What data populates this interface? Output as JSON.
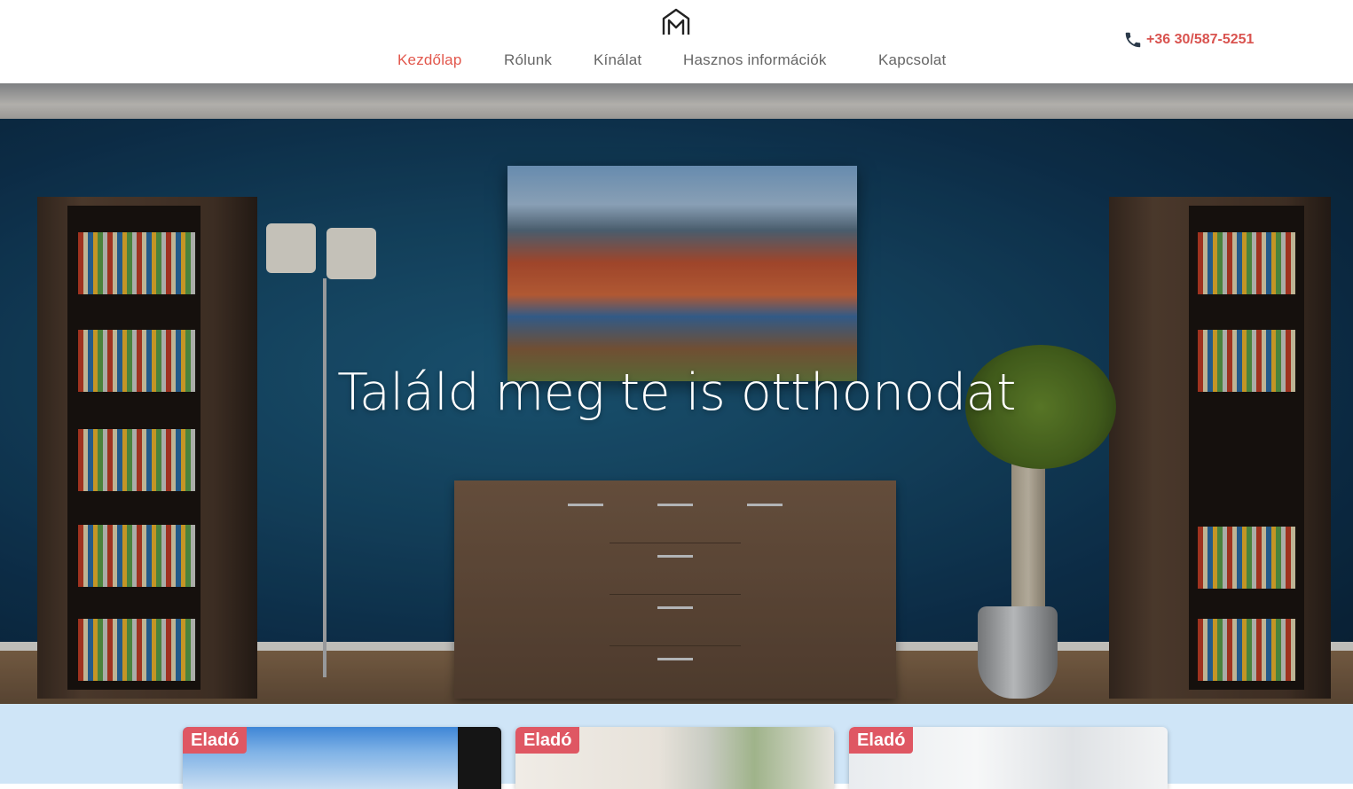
{
  "header": {
    "logo_icon": "house-m-logo-icon",
    "nav": [
      {
        "label": "Kezdőlap",
        "active": true
      },
      {
        "label": "Rólunk",
        "active": false
      },
      {
        "label": "Kínálat",
        "active": false
      },
      {
        "label": "Hasznos információk",
        "active": false
      },
      {
        "label": "Kapcsolat",
        "active": false
      }
    ],
    "phone": {
      "icon": "phone-icon",
      "number": "+36 30/587-5251"
    }
  },
  "hero": {
    "title": "Találd meg te is otthonodat"
  },
  "listings": [
    {
      "badge": "Eladó"
    },
    {
      "badge": "Eladó"
    },
    {
      "badge": "Eladó"
    }
  ],
  "colors": {
    "accent": "#e2574c",
    "badge": "#df5763",
    "listings_bg": "#cfe5f7",
    "nav_text": "#666666"
  }
}
